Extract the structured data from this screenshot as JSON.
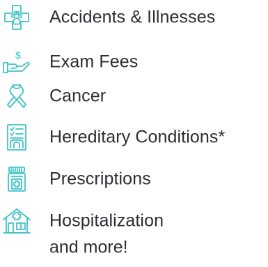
{
  "colors": {
    "icon": "#3fc3c7",
    "text": "#2b2d31"
  },
  "coverage": {
    "items": [
      {
        "icon": "paw-medical-cross-icon",
        "label": "Accidents & Illnesses"
      },
      {
        "icon": "hand-holding-money-icon",
        "label": "Exam Fees"
      },
      {
        "icon": "awareness-ribbon-icon",
        "label": "Cancer"
      },
      {
        "icon": "checklist-document-icon",
        "label": "Hereditary Conditions*"
      },
      {
        "icon": "prescription-bottle-icon",
        "label": "Prescriptions"
      },
      {
        "icon": "hospital-building-icon",
        "label": "Hospitalization"
      }
    ],
    "more": "and more!"
  }
}
